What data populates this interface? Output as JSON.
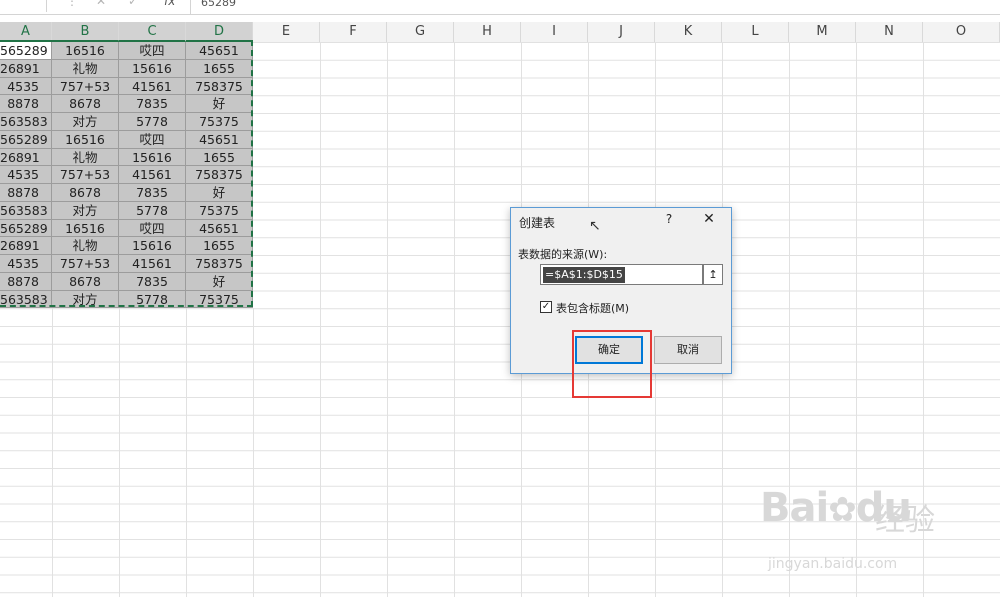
{
  "formula_bar": {
    "name_box": "",
    "cancel_glyph": "✕",
    "enter_glyph": "✓",
    "fx_label": "fx",
    "value": "65289"
  },
  "columns": [
    "A",
    "B",
    "C",
    "D",
    "E",
    "F",
    "G",
    "H",
    "I",
    "J",
    "K",
    "L",
    "M",
    "N",
    "O"
  ],
  "rows": [
    [
      "565289",
      "16516",
      "哎四",
      "45651"
    ],
    [
      "26891",
      "礼物",
      "15616",
      "1655"
    ],
    [
      "4535",
      "757+53",
      "41561",
      "758375"
    ],
    [
      "8878",
      "8678",
      "7835",
      "好"
    ],
    [
      "563583",
      "对方",
      "5778",
      "75375"
    ],
    [
      "565289",
      "16516",
      "哎四",
      "45651"
    ],
    [
      "26891",
      "礼物",
      "15616",
      "1655"
    ],
    [
      "4535",
      "757+53",
      "41561",
      "758375"
    ],
    [
      "8878",
      "8678",
      "7835",
      "好"
    ],
    [
      "563583",
      "对方",
      "5778",
      "75375"
    ],
    [
      "565289",
      "16516",
      "哎四",
      "45651"
    ],
    [
      "26891",
      "礼物",
      "15616",
      "1655"
    ],
    [
      "4535",
      "757+53",
      "41561",
      "758375"
    ],
    [
      "8878",
      "8678",
      "7835",
      "好"
    ],
    [
      "563583",
      "对方",
      "5778",
      "75375"
    ]
  ],
  "dialog": {
    "title": "创建表",
    "help": "?",
    "close": "✕",
    "source_label": "表数据的来源(W):",
    "source_value": "=$A$1:$D$15",
    "collapse_glyph": "↥",
    "has_headers_label": "表包含标题(M)",
    "has_headers_checked": true,
    "ok_label": "确定",
    "cancel_label": "取消"
  },
  "colors": {
    "accent_green": "#217346",
    "highlight_red": "#e53935",
    "dialog_border": "#5b9bd5"
  },
  "watermark": {
    "brand": "Bai",
    "brand_cn": "经验",
    "url": "jingyan.baidu.com"
  }
}
